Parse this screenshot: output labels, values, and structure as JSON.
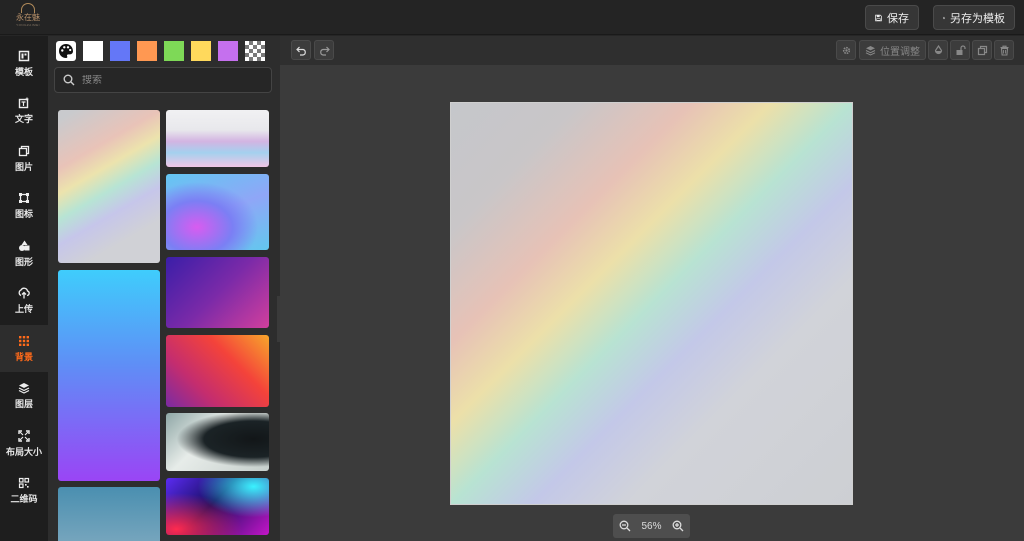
{
  "app": {
    "logo_text": "永在魅",
    "logo_subtext": "YONGZAIMEI"
  },
  "topbar": {
    "save_label": "保存",
    "save_template_label": "另存为模板"
  },
  "leftnav": [
    {
      "label": "模板",
      "icon": "template-icon"
    },
    {
      "label": "文字",
      "icon": "text-icon"
    },
    {
      "label": "图片",
      "icon": "image-icon"
    },
    {
      "label": "图标",
      "icon": "icon-icon"
    },
    {
      "label": "图形",
      "icon": "shapes-icon"
    },
    {
      "label": "上传",
      "icon": "upload-icon"
    },
    {
      "label": "背景",
      "icon": "background-icon",
      "active": true
    },
    {
      "label": "图层",
      "icon": "layers-icon"
    },
    {
      "label": "布局大小",
      "icon": "resize-icon"
    },
    {
      "label": "二维码",
      "icon": "qrcode-icon"
    }
  ],
  "panel": {
    "swatches": [
      "#ffffff",
      "#6477f7",
      "#ff9852",
      "#7ed957",
      "#ffd95c",
      "#c570ee",
      "transparent"
    ],
    "search": {
      "placeholder": "搜索",
      "value": ""
    }
  },
  "toolbar": {
    "position_label": "位置调整"
  },
  "zoom": {
    "level": "56%"
  },
  "colors": {
    "accent": "#ff6a1a",
    "panel_bg": "#2d2d2d",
    "workspace_bg": "#3b3b3b"
  }
}
